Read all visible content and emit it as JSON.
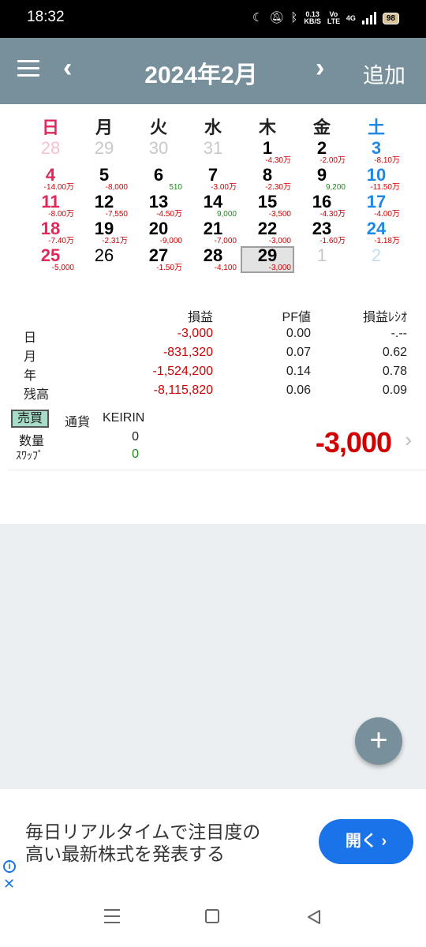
{
  "status": {
    "time": "18:32",
    "net_speed": "0.13",
    "net_unit": "KB/S",
    "volte": "Vo LTE",
    "network": "4G",
    "battery": "98"
  },
  "header": {
    "title": "2024年2月",
    "add_label": "追加"
  },
  "weekdays": [
    "日",
    "月",
    "火",
    "水",
    "木",
    "金",
    "土"
  ],
  "calendar": [
    [
      {
        "d": "28",
        "pl": ""
      },
      {
        "d": "29",
        "pl": ""
      },
      {
        "d": "30",
        "pl": ""
      },
      {
        "d": "31",
        "pl": ""
      },
      {
        "d": "1",
        "pl": "-4.30万"
      },
      {
        "d": "2",
        "pl": "-2.00万"
      },
      {
        "d": "3",
        "pl": "-8.10万"
      }
    ],
    [
      {
        "d": "4",
        "pl": "-14.00万"
      },
      {
        "d": "5",
        "pl": "-8,000"
      },
      {
        "d": "6",
        "pl": "510"
      },
      {
        "d": "7",
        "pl": "-3.00万"
      },
      {
        "d": "8",
        "pl": "-2.30万"
      },
      {
        "d": "9",
        "pl": "9,200"
      },
      {
        "d": "10",
        "pl": "-11.50万"
      }
    ],
    [
      {
        "d": "11",
        "pl": "-8.00万"
      },
      {
        "d": "12",
        "pl": "-7,550"
      },
      {
        "d": "13",
        "pl": "-4.50万"
      },
      {
        "d": "14",
        "pl": "9,000"
      },
      {
        "d": "15",
        "pl": "-3,500"
      },
      {
        "d": "16",
        "pl": "-4.30万"
      },
      {
        "d": "17",
        "pl": "-4.00万"
      }
    ],
    [
      {
        "d": "18",
        "pl": "-7.40万"
      },
      {
        "d": "19",
        "pl": "-2.31万"
      },
      {
        "d": "20",
        "pl": "-9,000"
      },
      {
        "d": "21",
        "pl": "-7,000"
      },
      {
        "d": "22",
        "pl": "-3,000"
      },
      {
        "d": "23",
        "pl": "-1.60万"
      },
      {
        "d": "24",
        "pl": "-1.18万"
      }
    ],
    [
      {
        "d": "25",
        "pl": "-5,000"
      },
      {
        "d": "26",
        "pl": ""
      },
      {
        "d": "27",
        "pl": "-1.50万"
      },
      {
        "d": "28",
        "pl": "-4,100"
      },
      {
        "d": "29",
        "pl": "-3,000"
      },
      {
        "d": "1",
        "pl": ""
      },
      {
        "d": "2",
        "pl": ""
      }
    ]
  ],
  "stats": {
    "headers": [
      "損益",
      "PF値",
      "損益ﾚｼｵ"
    ],
    "rows": [
      {
        "label": "日",
        "pl": "-3,000",
        "pf": "0.00",
        "ratio": "-.--"
      },
      {
        "label": "月",
        "pl": "-831,320",
        "pf": "0.07",
        "ratio": "0.62"
      },
      {
        "label": "年",
        "pl": "-1,524,200",
        "pf": "0.14",
        "ratio": "0.78"
      },
      {
        "label": "残高",
        "pl": "-8,115,820",
        "pf": "0.06",
        "ratio": "0.09"
      }
    ]
  },
  "trade": {
    "type_badge": "売買",
    "currency_label": "通貨",
    "currency": "KEIRIN",
    "qty_label": "数量",
    "qty": "0",
    "swap_label": "ｽﾜｯﾌﾟ",
    "swap": "0",
    "pl": "-3,000"
  },
  "fab_label": "+",
  "ad": {
    "text_line1": "毎日リアルタイムで注目度の",
    "text_line2": "高い最新株式を発表する",
    "button": "開く ›"
  }
}
